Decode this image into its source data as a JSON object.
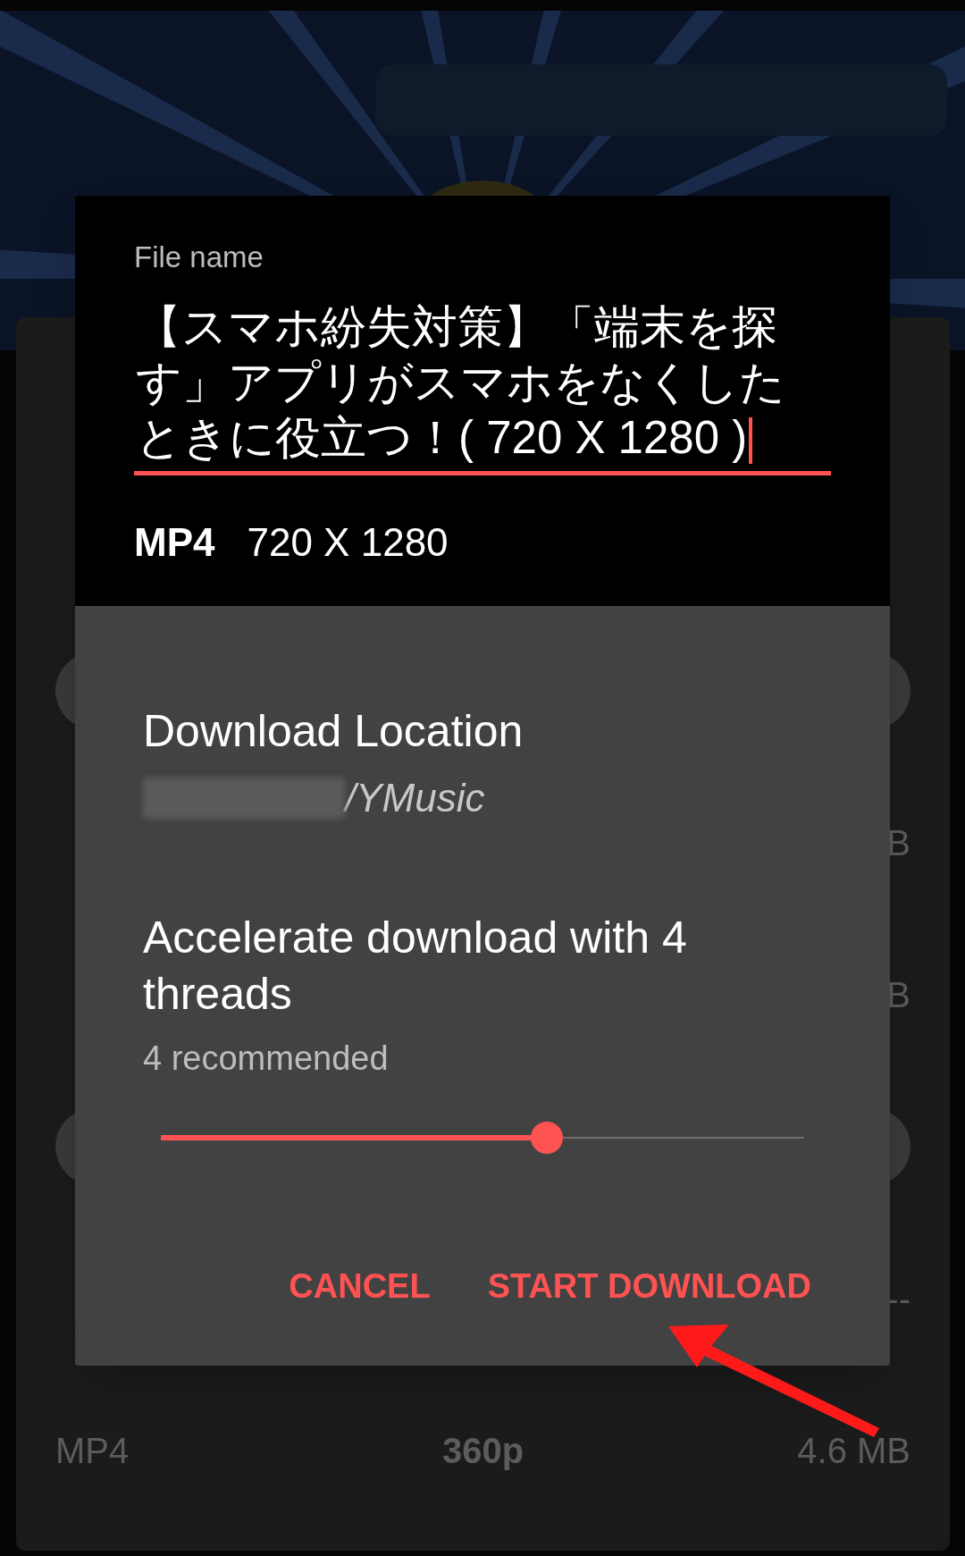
{
  "sheet_items": [
    {
      "kind": "pill"
    },
    {
      "kind": "row",
      "column_3": "B"
    },
    {
      "kind": "row",
      "column_3": "B"
    },
    {
      "kind": "pill"
    },
    {
      "kind": "row",
      "column_3": "--"
    },
    {
      "kind": "row",
      "column_1": "MP4",
      "column_2": "360p",
      "column_3": "4.6 MB"
    }
  ],
  "dialog": {
    "file_name_label": "File name",
    "file_name_value": "【スマホ紛失対策】「端末を探す」アプリがスマホをなくしたときに役立つ！( 720 X 1280 )",
    "format": "MP4",
    "resolution": "720 X 1280",
    "location_title": "Download Location",
    "location_path": "/YMusic",
    "threads_title": "Accelerate download with 4 threads",
    "threads_hint": "4 recommended",
    "threads_slider": {
      "level": 0.6
    },
    "buttons": [
      "CANCEL",
      "START DOWNLOAD"
    ]
  }
}
